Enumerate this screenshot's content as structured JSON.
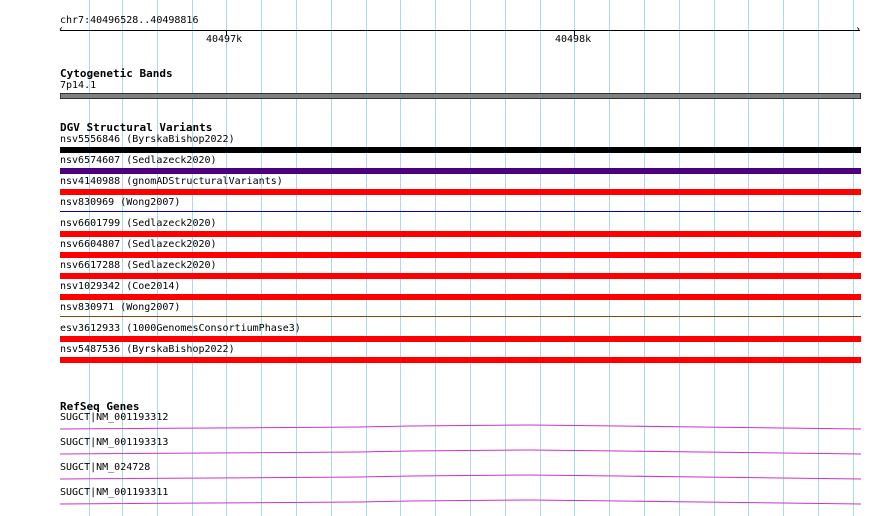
{
  "ruler": {
    "location": "chr7:40496528..40498816",
    "tick_labels": [
      "40497k",
      "40498k"
    ]
  },
  "cytoband": {
    "title": "Cytogenetic Bands",
    "label": "7p14.1",
    "color": "#808080"
  },
  "dgv": {
    "title": "DGV Structural Variants",
    "items": [
      {
        "label": "nsv5556846 (ByrskaBishop2022)",
        "color": "#000000",
        "style": "thick"
      },
      {
        "label": "nsv6574607 (Sedlazeck2020)",
        "color": "#4b0082",
        "style": "thick"
      },
      {
        "label": "nsv4140988 (gnomADStructuralVariants)",
        "color": "#ff0000",
        "style": "thick"
      },
      {
        "label": "nsv830969 (Wong2007)",
        "color": "#0000cc",
        "style": "thin"
      },
      {
        "label": "nsv6601799 (Sedlazeck2020)",
        "color": "#ff0000",
        "style": "thick"
      },
      {
        "label": "nsv6604807 (Sedlazeck2020)",
        "color": "#ff0000",
        "style": "thick"
      },
      {
        "label": "nsv6617288 (Sedlazeck2020)",
        "color": "#ff0000",
        "style": "thick"
      },
      {
        "label": "nsv1029342 (Coe2014)",
        "color": "#ff0000",
        "style": "thick"
      },
      {
        "label": "nsv830971 (Wong2007)",
        "color": "#8b4513",
        "style": "thin"
      },
      {
        "label": "esv3612933 (1000GenomesConsortiumPhase3)",
        "color": "#ff0000",
        "style": "thick"
      },
      {
        "label": "nsv5487536 (ByrskaBishop2022)",
        "color": "#ff0000",
        "style": "thick"
      }
    ]
  },
  "refseq": {
    "title": "RefSeq Genes",
    "color": "#cc33cc",
    "items": [
      {
        "label": "SUGCT|NM_001193312"
      },
      {
        "label": "SUGCT|NM_001193313"
      },
      {
        "label": "SUGCT|NM_024728"
      },
      {
        "label": "SUGCT|NM_001193311"
      }
    ]
  },
  "colors": {
    "grid": "#add8e6",
    "ruler": "#000000"
  }
}
